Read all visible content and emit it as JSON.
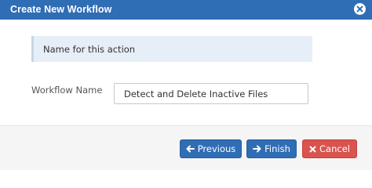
{
  "dialog": {
    "title": "Create New Workflow",
    "close_icon": "close-circle-icon",
    "hint": "Name for this action",
    "workflow_name_label": "Workflow Name",
    "workflow_name_value": "Detect and Delete Inactive Files"
  },
  "footer": {
    "previous_label": "Previous",
    "previous_icon": "arrow-left-icon",
    "finish_label": "Finish",
    "finish_icon": "arrow-right-icon",
    "cancel_label": "Cancel",
    "cancel_icon": "close-icon"
  },
  "colors": {
    "titlebar": "#2f6db5",
    "primary": "#2f6db5",
    "danger": "#d9534f",
    "hint_background": "#e6eef8"
  }
}
